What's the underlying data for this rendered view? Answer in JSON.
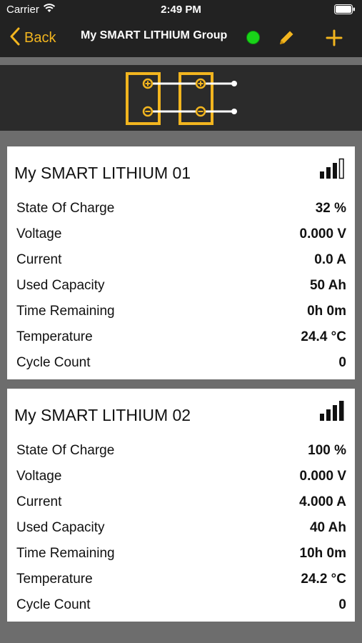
{
  "status_bar": {
    "carrier": "Carrier",
    "time": "2:49 PM"
  },
  "nav": {
    "back_label": "Back",
    "title": "My SMART LITHIUM Group",
    "accent": "#f2b51f",
    "connection_color": "#19d419"
  },
  "batteries": [
    {
      "name": "My SMART LITHIUM 01",
      "signal_icon": "signal-strength-icon",
      "rows": [
        {
          "label": "State Of Charge",
          "value": "32 %"
        },
        {
          "label": "Voltage",
          "value": "0.000 V"
        },
        {
          "label": "Current",
          "value": "0.0 A"
        },
        {
          "label": "Used Capacity",
          "value": "50 Ah"
        },
        {
          "label": "Time Remaining",
          "value": "0h 0m"
        },
        {
          "label": "Temperature",
          "value": "24.4 °C"
        },
        {
          "label": "Cycle Count",
          "value": "0"
        }
      ]
    },
    {
      "name": "My SMART LITHIUM 02",
      "signal_icon": "signal-strength-icon",
      "rows": [
        {
          "label": "State Of Charge",
          "value": "100 %"
        },
        {
          "label": "Voltage",
          "value": "0.000 V"
        },
        {
          "label": "Current",
          "value": "4.000 A"
        },
        {
          "label": "Used Capacity",
          "value": "40 Ah"
        },
        {
          "label": "Time Remaining",
          "value": "10h 0m"
        },
        {
          "label": "Temperature",
          "value": "24.2 °C"
        },
        {
          "label": "Cycle Count",
          "value": "0"
        }
      ]
    }
  ]
}
